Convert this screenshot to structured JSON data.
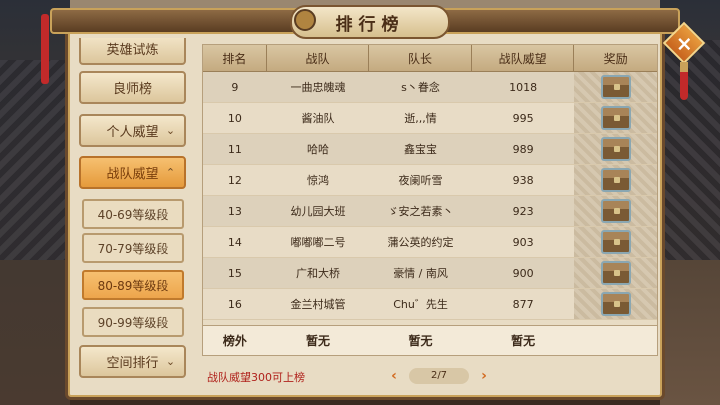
{
  "title": "排行榜",
  "close_label": "×",
  "sidebar": {
    "items": [
      {
        "label": "英雄试炼"
      },
      {
        "label": "良师榜"
      },
      {
        "label": "个人威望"
      },
      {
        "label": "战队威望"
      },
      {
        "label": "空间排行"
      }
    ],
    "sub_items": [
      {
        "label": "40-69等级段"
      },
      {
        "label": "70-79等级段"
      },
      {
        "label": "80-89等级段"
      },
      {
        "label": "90-99等级段"
      }
    ],
    "chevron_down": "⌄",
    "chevron_up": "⌃"
  },
  "table": {
    "headers": [
      "排名",
      "战队",
      "队长",
      "战队威望",
      "奖励"
    ],
    "rows": [
      {
        "rank": "9",
        "team": "一曲忠魄魂",
        "captain": "s丶眷念",
        "prestige": "1018"
      },
      {
        "rank": "10",
        "team": "酱油队",
        "captain": "逝,,,情",
        "prestige": "995"
      },
      {
        "rank": "11",
        "team": "哈哈",
        "captain": "鑫宝宝",
        "prestige": "989"
      },
      {
        "rank": "12",
        "team": "惊鸿",
        "captain": "夜阑听雪",
        "prestige": "938"
      },
      {
        "rank": "13",
        "team": "幼儿园大班",
        "captain": "ゞ安之若素丶",
        "prestige": "923"
      },
      {
        "rank": "14",
        "team": "嘟嘟嘟二号",
        "captain": "蒲公英的约定",
        "prestige": "903"
      },
      {
        "rank": "15",
        "team": "广和大桥",
        "captain": "豪情 / 南风",
        "prestige": "900"
      },
      {
        "rank": "16",
        "team": "金兰村城管",
        "captain": "Chu゛先生",
        "prestige": "877"
      }
    ],
    "footer": {
      "rank": "榜外",
      "team": "暂无",
      "captain": "暂无",
      "prestige": "暂无"
    }
  },
  "note": "战队威望300可上榜",
  "pager": {
    "prev": "‹",
    "page": "2/7",
    "next": "›"
  },
  "colors": {
    "accent": "#e59a3b",
    "note": "#b0221c",
    "panel": "#e8dcc4"
  }
}
